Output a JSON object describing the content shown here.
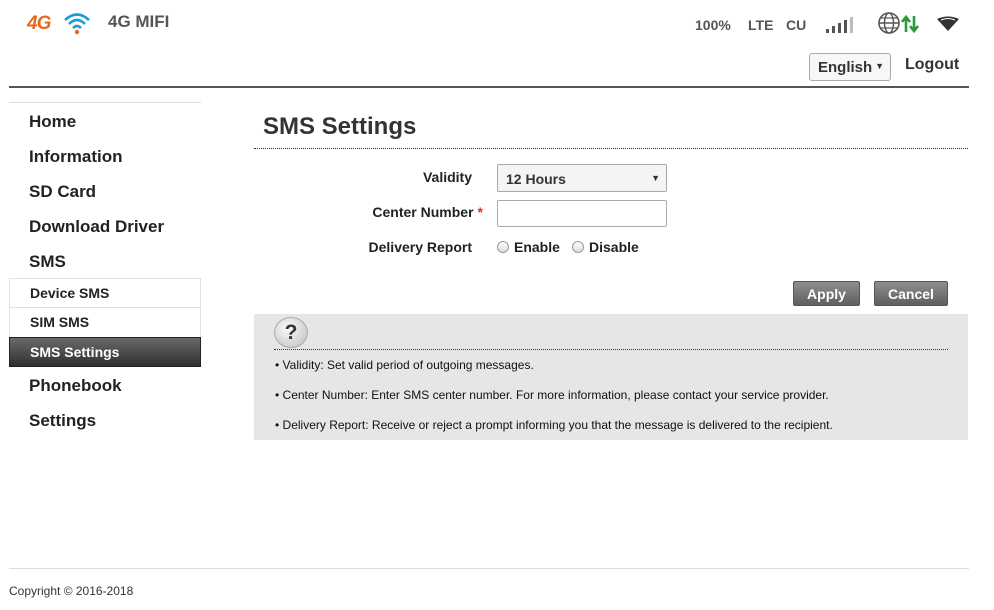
{
  "header": {
    "logo_text": "4G",
    "device_name": "4G MIFI",
    "battery": "100%",
    "network_type": "LTE",
    "operator": "CU",
    "icons": [
      "wifi-logo-icon",
      "signal-bars-icon",
      "globe-icon",
      "data-transfer-icon",
      "wifi-status-icon"
    ],
    "language": "English",
    "logout_label": "Logout"
  },
  "sidebar": {
    "items": [
      {
        "label": "Home"
      },
      {
        "label": "Information"
      },
      {
        "label": "SD Card"
      },
      {
        "label": "Download Driver"
      },
      {
        "label": "SMS"
      }
    ],
    "sms_subitems": [
      {
        "label": "Device SMS"
      },
      {
        "label": "SIM SMS"
      },
      {
        "label": "SMS Settings",
        "active": true
      }
    ],
    "items_after": [
      {
        "label": "Phonebook"
      },
      {
        "label": "Settings"
      }
    ]
  },
  "main": {
    "title": "SMS Settings",
    "form": {
      "validity_label": "Validity",
      "validity_value": "12 Hours",
      "center_number_label": "Center Number",
      "required_mark": "*",
      "center_number_value": "",
      "delivery_report_label": "Delivery Report",
      "enable_label": "Enable",
      "disable_label": "Disable",
      "delivery_report_selected": null
    },
    "buttons": {
      "apply": "Apply",
      "cancel": "Cancel"
    },
    "help": {
      "icon_glyph": "?",
      "lines": [
        "• Validity: Set valid period of outgoing messages.",
        "• Center Number: Enter SMS center number. For more information, please contact your service provider.",
        "• Delivery Report: Receive or reject a prompt informing you that the message is delivered to the recipient."
      ]
    }
  },
  "footer": {
    "copyright": "Copyright © 2016-2018"
  },
  "colors": {
    "brand_orange": "#e36a1d",
    "wifi_blue": "#1e9bd7",
    "transfer_green": "#2a9a3a",
    "active_nav_bg": "#3f3f3f",
    "button_bg": "#777777",
    "help_bg": "#e6e6e6"
  }
}
